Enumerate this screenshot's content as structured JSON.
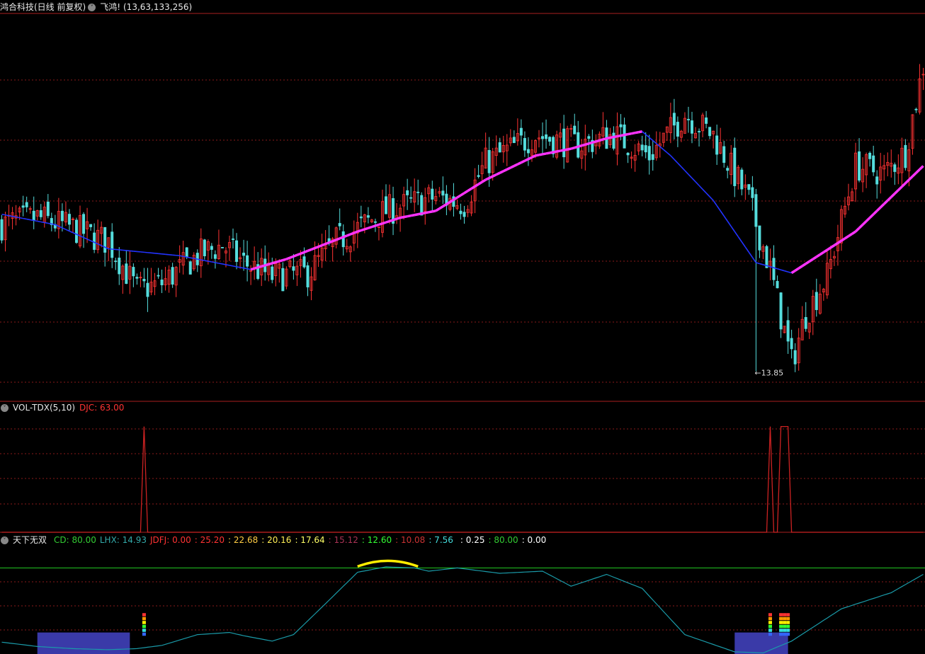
{
  "header": {
    "stock_title": "鸿合科技(日线 前复权)",
    "indicator_name": "飞鸿!",
    "indicator_params": "(13,63,133,256)"
  },
  "vol_panel": {
    "title": "VOL-TDX(5,10)",
    "djc_label": "DJC: 63.00"
  },
  "osc_panel": {
    "title": "天下无双",
    "readouts": [
      {
        "text": "CD: 80.00",
        "color": "#33cc33"
      },
      {
        "text": "LHX: 14.93",
        "color": "#33aaaa"
      },
      {
        "text": "JDFJ: 0.00",
        "color": "#ff3333"
      },
      {
        "text": ": 25.20",
        "color": "#ff3333"
      },
      {
        "text": ": 22.68",
        "color": "#ffcc44"
      },
      {
        "text": ": 20.16",
        "color": "#ffee55"
      },
      {
        "text": ": 17.64",
        "color": "#ffff66"
      },
      {
        "text": ": 15.12",
        "color": "#aa3355"
      },
      {
        "text": ": 12.60",
        "color": "#33ff33"
      },
      {
        "text": ": 10.08",
        "color": "#cc3333"
      },
      {
        "text": ": 7.56",
        "color": "#44dddd"
      },
      {
        "text": "",
        "color": "#3333aa"
      },
      {
        "text": ": 0.25",
        "color": "#ffffff"
      },
      {
        "text": ": 80.00",
        "color": "#33cc33"
      },
      {
        "text": ": 0.00",
        "color": "#ffffff"
      }
    ]
  },
  "colors": {
    "bg": "#000000",
    "grid": "#8a1a1a",
    "separator": "#aa2020",
    "up": "#ff3333",
    "down": "#55dddd",
    "ma_up": "#ff33ff",
    "ma_down": "#2233ff",
    "vol": "#cc2222",
    "osc_line": "#1a9aa8",
    "osc_level": "#22cc22",
    "zone": "#3a3aa8",
    "highlight": "#ffee00"
  },
  "chart_data": [
    {
      "type": "candlestick",
      "title": "鸿合科技(日线 前复权)",
      "n_bars": 260,
      "price_range": [
        13.0,
        24.2
      ],
      "low_marker": {
        "label": "13.85",
        "value": 13.85,
        "bar": 212
      },
      "close_path": [
        [
          0,
          18.1
        ],
        [
          10,
          18.3
        ],
        [
          20,
          18.0
        ],
        [
          30,
          17.6
        ],
        [
          38,
          16.2
        ],
        [
          45,
          16.4
        ],
        [
          55,
          17.2
        ],
        [
          62,
          17.5
        ],
        [
          68,
          17.0
        ],
        [
          76,
          16.6
        ],
        [
          86,
          16.7
        ],
        [
          94,
          17.6
        ],
        [
          108,
          18.5
        ],
        [
          122,
          18.9
        ],
        [
          130,
          18.7
        ],
        [
          136,
          19.9
        ],
        [
          150,
          20.7
        ],
        [
          162,
          20.4
        ],
        [
          172,
          20.7
        ],
        [
          182,
          20.1
        ],
        [
          192,
          21.3
        ],
        [
          200,
          20.7
        ],
        [
          210,
          18.8
        ],
        [
          216,
          16.8
        ],
        [
          222,
          14.1
        ],
        [
          226,
          15.5
        ],
        [
          232,
          16.6
        ],
        [
          240,
          19.8
        ],
        [
          248,
          19.6
        ],
        [
          254,
          20.2
        ],
        [
          259,
          22.7
        ]
      ],
      "ma_path": [
        [
          0,
          18.4
        ],
        [
          15,
          18.1
        ],
        [
          30,
          17.4
        ],
        [
          50,
          17.2
        ],
        [
          70,
          16.8
        ],
        [
          80,
          17.1
        ],
        [
          100,
          17.9
        ],
        [
          112,
          18.3
        ],
        [
          122,
          18.5
        ],
        [
          136,
          19.4
        ],
        [
          150,
          20.1
        ],
        [
          160,
          20.3
        ],
        [
          170,
          20.6
        ],
        [
          180,
          20.8
        ],
        [
          188,
          20.1
        ],
        [
          200,
          18.8
        ],
        [
          212,
          17.0
        ],
        [
          222,
          16.7
        ],
        [
          240,
          17.9
        ],
        [
          259,
          19.8
        ]
      ]
    },
    {
      "type": "line",
      "title": "VOL-TDX(5,10)",
      "series": [
        {
          "name": "DJC",
          "spikes": [
            {
              "bar": 40,
              "value": 63
            },
            {
              "bar": 216,
              "value": 63
            },
            {
              "bar": 219,
              "value": 63
            },
            {
              "bar": 220,
              "value": 63
            },
            {
              "bar": 221,
              "value": 63
            }
          ]
        }
      ],
      "ylim": [
        0,
        70
      ]
    },
    {
      "type": "line",
      "title": "天下无双",
      "levels": [
        80
      ],
      "ylim": [
        0,
        100
      ],
      "series": [
        {
          "name": "LHX",
          "points": [
            [
              0,
              11
            ],
            [
              10,
              7
            ],
            [
              20,
              5
            ],
            [
              30,
              4
            ],
            [
              38,
              5
            ],
            [
              45,
              8
            ],
            [
              55,
              18
            ],
            [
              64,
              20
            ],
            [
              68,
              17
            ],
            [
              76,
              12
            ],
            [
              82,
              18
            ],
            [
              92,
              50
            ],
            [
              100,
              76
            ],
            [
              108,
              81
            ],
            [
              116,
              80
            ],
            [
              120,
              77
            ],
            [
              128,
              80
            ],
            [
              140,
              75
            ],
            [
              152,
              77
            ],
            [
              160,
              63
            ],
            [
              170,
              74
            ],
            [
              180,
              61
            ],
            [
              192,
              18
            ],
            [
              206,
              2
            ],
            [
              214,
              1
            ],
            [
              222,
              12
            ],
            [
              236,
              42
            ],
            [
              250,
              57
            ],
            [
              259,
              74
            ]
          ]
        }
      ],
      "zones": [
        {
          "from": 10,
          "to": 36
        },
        {
          "from": 206,
          "to": 221
        }
      ]
    }
  ]
}
